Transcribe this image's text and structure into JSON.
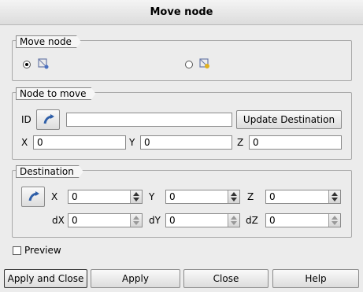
{
  "window": {
    "title": "Move node"
  },
  "move_mode": {
    "title": "Move node",
    "options": [
      {
        "icon": "move-node-by-id-icon",
        "selected": true
      },
      {
        "icon": "move-node-by-point-icon",
        "selected": false
      }
    ]
  },
  "node_to_move": {
    "title": "Node to move",
    "id_label": "ID",
    "id_value": "",
    "update_button": "Update Destination",
    "x_label": "X",
    "x_value": "0",
    "y_label": "Y",
    "y_value": "0",
    "z_label": "Z",
    "z_value": "0"
  },
  "destination": {
    "title": "Destination",
    "x_label": "X",
    "x_value": "0",
    "y_label": "Y",
    "y_value": "0",
    "z_label": "Z",
    "z_value": "0",
    "dx_label": "dX",
    "dx_value": "0",
    "dy_label": "dY",
    "dy_value": "0",
    "dz_label": "dZ",
    "dz_value": "0"
  },
  "preview": {
    "label": "Preview",
    "checked": false
  },
  "buttons": {
    "apply_close": "Apply and Close",
    "apply": "Apply",
    "close": "Close",
    "help": "Help"
  }
}
